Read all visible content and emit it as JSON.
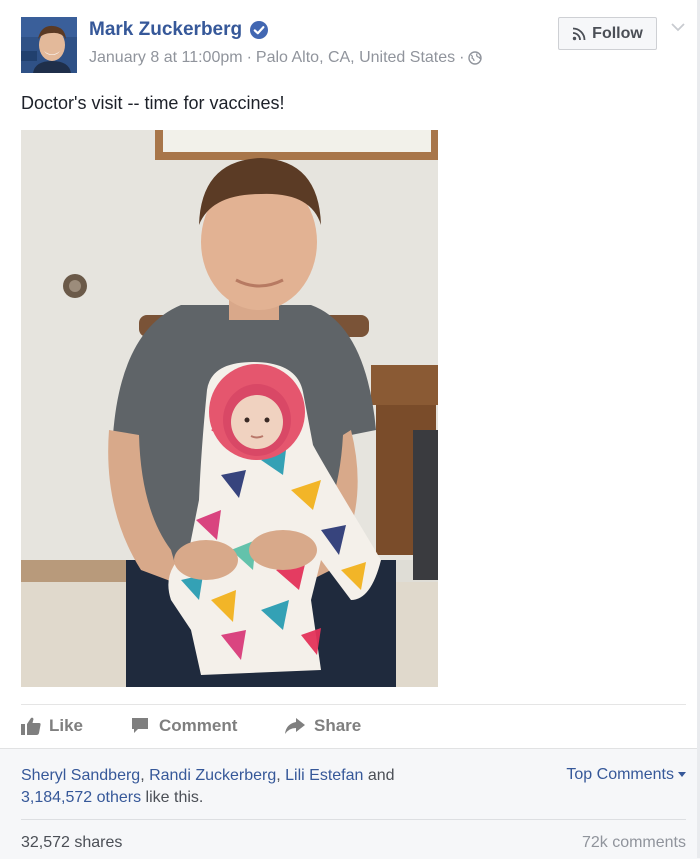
{
  "post": {
    "author": "Mark Zuckerberg",
    "date": "January 8 at 11:00pm",
    "separator": "·",
    "location": "Palo Alto, CA, United States",
    "follow_label": "Follow",
    "text": "Doctor's visit -- time for vaccines!"
  },
  "actions": {
    "like": "Like",
    "comment": "Comment",
    "share": "Share"
  },
  "footer": {
    "likers": [
      "Sheryl Sandberg",
      "Randi Zuckerberg",
      "Lili Estefan"
    ],
    "sep1": ", ",
    "sep2": ", ",
    "and": " and",
    "others": "3,184,572 others",
    "like_this": " like this.",
    "top_comments": "Top Comments",
    "shares": "32,572 shares",
    "comments": "72k comments"
  },
  "colors": {
    "link_blue": "#365899",
    "verified_blue": "#4267b2",
    "muted_gray": "#90949c"
  },
  "icons": {
    "verified": "verified-badge-icon",
    "globe": "globe-icon",
    "rss": "rss-icon",
    "chevron": "chevron-down-icon",
    "like": "thumbs-up-icon",
    "comment": "speech-bubble-icon",
    "share": "share-arrow-icon"
  }
}
